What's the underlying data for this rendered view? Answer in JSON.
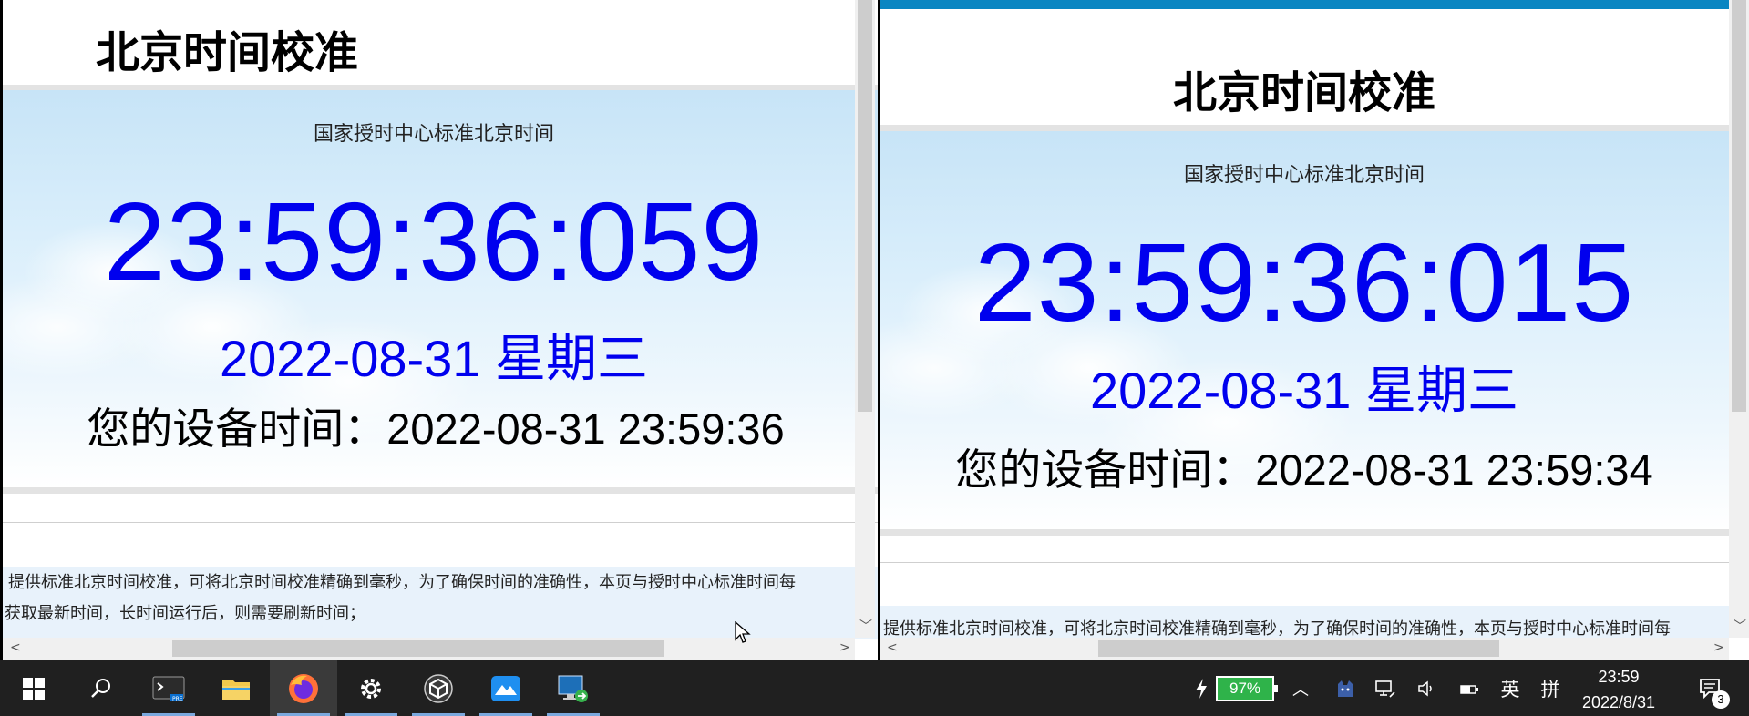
{
  "left": {
    "title": "北京时间校准",
    "subtitle": "国家授时中心标准北京时间",
    "time": "23:59:36:059",
    "date": "2022-08-31 星期三",
    "device_time": "您的设备时间：2022-08-31 23:59:36",
    "desc_line1": "提供标准北京时间校准，可将北京时间校准精确到毫秒，为了确保时间的准确性，本页与授时中心标准时间每",
    "desc_line2": "获取最新时间，长时间运行后，则需要刷新时间；"
  },
  "right": {
    "title": "北京时间校准",
    "subtitle": "国家授时中心标准北京时间",
    "time": "23:59:36:015",
    "date": "2022-08-31 星期三",
    "device_time": "您的设备时间：2022-08-31 23:59:34",
    "desc_line1": "提供标准北京时间校准，可将北京时间校准精确到毫秒，为了确保时间的准确性，本页与授时中心标准时间每"
  },
  "taskbar": {
    "battery": "97%",
    "ime_lang": "英",
    "ime_mode": "拼",
    "clock_time": "23:59",
    "clock_date": "2022/8/31",
    "notification_count": "3",
    "icons": [
      "windows-start-icon",
      "search-icon",
      "terminal-preview-icon",
      "file-explorer-icon",
      "firefox-icon",
      "settings-gear-icon",
      "unity-hub-icon",
      "mountain-app-icon",
      "remote-desktop-icon"
    ]
  },
  "colors": {
    "time_blue": "#0000ee",
    "accent_bar": "#0a86c2",
    "taskbar_bg": "#202020",
    "battery_green": "#2fb34a"
  }
}
